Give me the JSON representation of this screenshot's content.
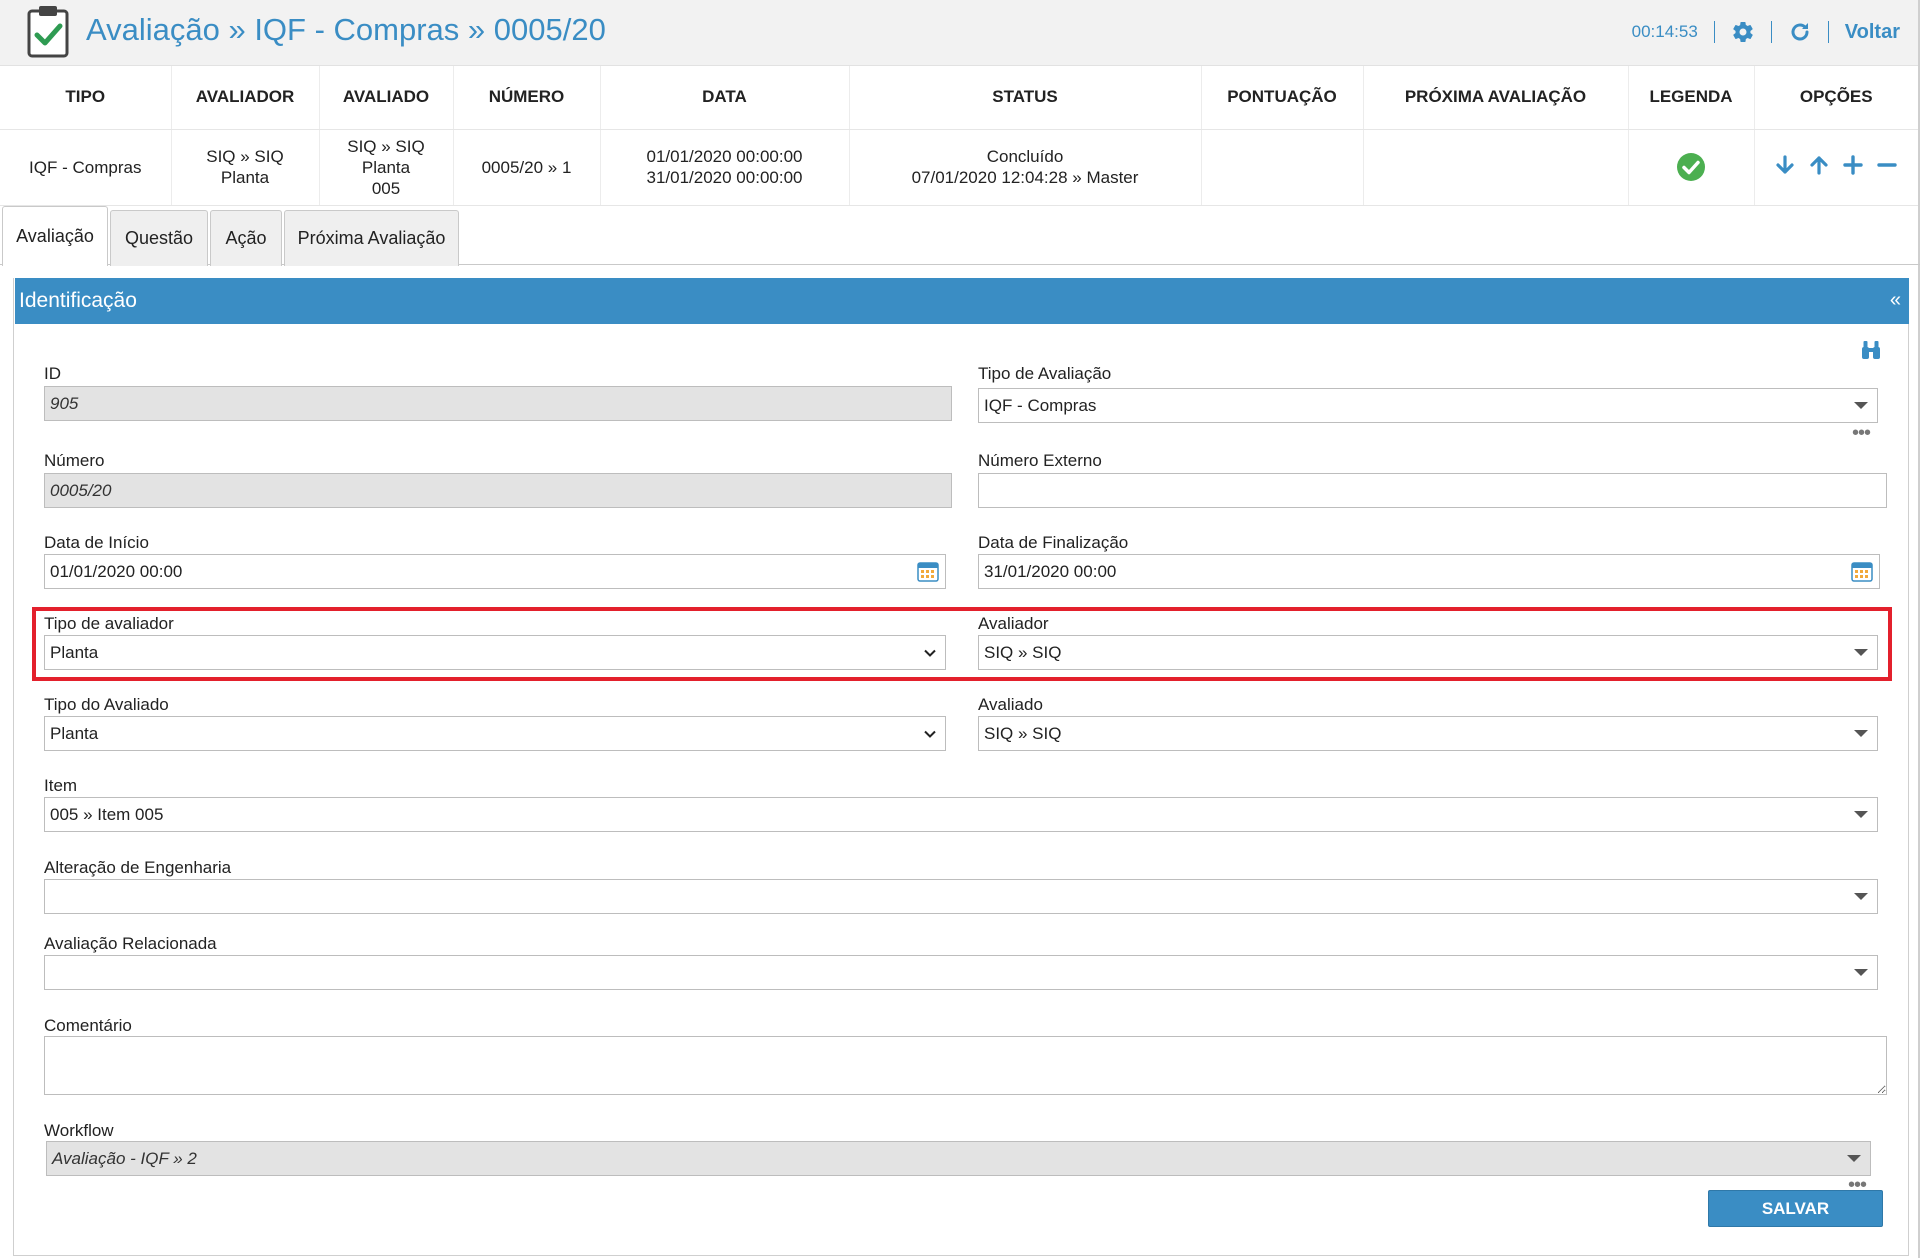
{
  "header": {
    "title": "Avaliação » IQF - Compras » 0005/20",
    "timer": "00:14:53",
    "back_label": "Voltar",
    "accent_color": "#3a8dc4"
  },
  "summary": {
    "columns": [
      "TIPO",
      "AVALIADOR",
      "AVALIADO",
      "NÚMERO",
      "DATA",
      "STATUS",
      "PONTUAÇÃO",
      "PRÓXIMA AVALIAÇÃO",
      "LEGENDA",
      "OPÇÕES"
    ],
    "row": {
      "tipo": "IQF - Compras",
      "avaliador": [
        "SIQ » SIQ",
        "Planta"
      ],
      "avaliado": [
        "SIQ » SIQ",
        "Planta",
        "005"
      ],
      "numero": "0005/20 » 1",
      "data": [
        "01/01/2020 00:00:00",
        "31/01/2020 00:00:00"
      ],
      "status": [
        "Concluído",
        "07/01/2020 12:04:28 » Master"
      ],
      "pontuacao": "",
      "proxima": "",
      "legend_icon": "check-circle-icon",
      "legend_color": "#4caf50",
      "option_icons": [
        "arrow-down-icon",
        "arrow-up-icon",
        "plus-icon",
        "minus-icon"
      ]
    }
  },
  "tabs": [
    "Avaliação",
    "Questão",
    "Ação",
    "Próxima Avaliação"
  ],
  "panel": {
    "title": "Identificação",
    "collapse": "«"
  },
  "form": {
    "id_label": "ID",
    "id_value": "905",
    "tipo_avaliacao_label": "Tipo de Avaliação",
    "tipo_avaliacao_value": "IQF - Compras",
    "numero_label": "Número",
    "numero_value": "0005/20",
    "numero_externo_label": "Número Externo",
    "numero_externo_value": "",
    "data_inicio_label": "Data de Início",
    "data_inicio_value": "01/01/2020 00:00",
    "data_fim_label": "Data de Finalização",
    "data_fim_value": "31/01/2020 00:00",
    "tipo_avaliador_label": "Tipo de avaliador",
    "tipo_avaliador_value": "Planta",
    "avaliador_label": "Avaliador",
    "avaliador_value": "SIQ » SIQ",
    "tipo_avaliado_label": "Tipo do Avaliado",
    "tipo_avaliado_value": "Planta",
    "avaliado_label": "Avaliado",
    "avaliado_value": "SIQ » SIQ",
    "item_label": "Item",
    "item_value": "005 » Item 005",
    "alteracao_label": "Alteração de Engenharia",
    "alteracao_value": "",
    "relacionada_label": "Avaliação Relacionada",
    "relacionada_value": "",
    "comentario_label": "Comentário",
    "comentario_value": "",
    "workflow_label": "Workflow",
    "workflow_value": "Avaliação - IQF » 2",
    "save_label": "SALVAR"
  },
  "highlight_color": "#e3202c"
}
